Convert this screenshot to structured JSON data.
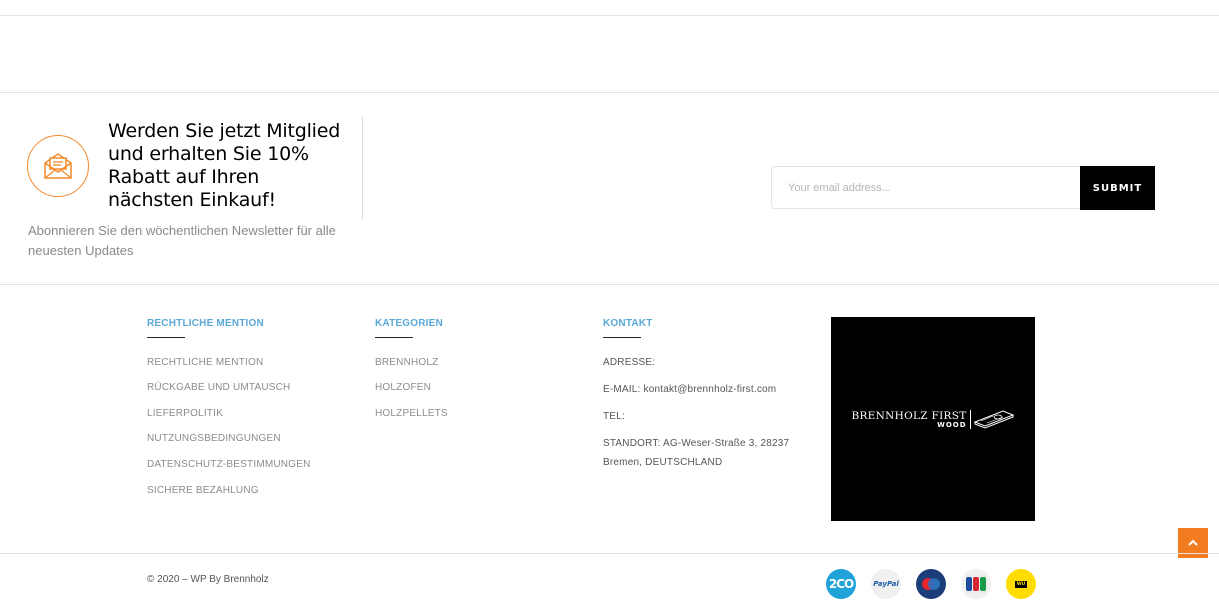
{
  "newsletter": {
    "title": "Werden Sie jetzt Mitglied und erhalten Sie 10% Rabatt auf Ihren nächsten Einkauf!",
    "subtitle": "Abonnieren Sie den wöchentlichen Newsletter für alle neuesten Updates",
    "email_placeholder": "Your email address...",
    "submit_label": "SUBMIT",
    "icon": "envelope-icon",
    "accent_color": "#f28a2c"
  },
  "footer": {
    "legal": {
      "heading": "RECHTLICHE MENTION",
      "items": [
        "RECHTLICHE MENTION",
        "RÜCKGABE UND UMTAUSCH",
        "LIEFERPOLITIK",
        "NUTZUNGSBEDINGUNGEN",
        "DATENSCHUTZ-BESTIMMUNGEN",
        "SICHERE BEZAHLUNG"
      ]
    },
    "categories": {
      "heading": "KATEGORIEN",
      "items": [
        "BRENNHOLZ",
        "HOLZOFEN",
        "HOLZPELLETS"
      ]
    },
    "contact": {
      "heading": "KONTAKT",
      "address": "ADRESSE:",
      "email": "E-MAIL: kontakt@brennholz-first.com",
      "tel": "TEL:",
      "location_line1": "STANDORT: AG-Weser-Straße 3, 28237",
      "location_line2": "Bremen, DEUTSCHLAND"
    },
    "brand": {
      "name": "BRENNHOLZ FIRST",
      "sub": "WOOD"
    },
    "heading_color": "#5aa8d6"
  },
  "bottom": {
    "copyright": "© 2020 – WP By Brennholz",
    "payments": [
      {
        "name": "2CO",
        "icon": "2checkout-icon"
      },
      {
        "name": "PayPal",
        "icon": "paypal-icon"
      },
      {
        "name": "Maestro",
        "icon": "maestro-icon"
      },
      {
        "name": "JCB",
        "icon": "jcb-icon"
      },
      {
        "name": "WESTERN UNION",
        "icon": "western-union-icon"
      }
    ],
    "scroll_top_icon": "chevron-up-icon",
    "scroll_top_color": "#f37c21"
  }
}
